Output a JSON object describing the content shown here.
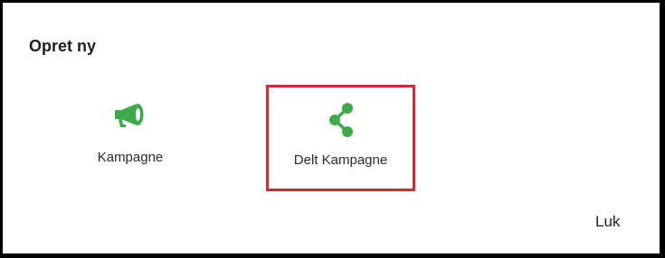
{
  "dialog": {
    "title": "Opret ny",
    "options": [
      {
        "label": "Kampagne",
        "icon": "megaphone-icon"
      },
      {
        "label": "Delt Kampagne",
        "icon": "share-icon",
        "selected": true
      }
    ],
    "close_label": "Luk"
  },
  "colors": {
    "icon_green": "#3daa4a",
    "highlight_border": "#d12b30",
    "frame": "#000000"
  }
}
